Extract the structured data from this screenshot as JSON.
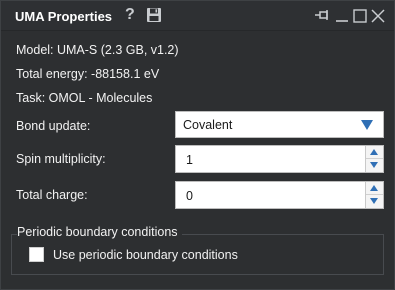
{
  "window": {
    "title": "UMA Properties",
    "help_icon_glyph": "?"
  },
  "info": {
    "model": "Model: UMA-S (2.3 GB, v1.2)",
    "total_energy": "Total energy: -88158.1 eV",
    "task": "Task: OMOL - Molecules"
  },
  "fields": {
    "bond_update_label": "Bond update:",
    "bond_update_value": "Covalent",
    "spin_label": "Spin multiplicity:",
    "spin_value": "1",
    "charge_label": "Total charge:",
    "charge_value": "0"
  },
  "periodic": {
    "group_title": "Periodic boundary conditions",
    "checkbox_label": "Use periodic boundary conditions",
    "checked": false
  },
  "icons": [
    "help-icon",
    "save-icon",
    "pin-icon",
    "minimize-icon",
    "maximize-icon",
    "close-icon",
    "chevron-down-icon",
    "spin-up-icon",
    "spin-down-icon"
  ],
  "colors": {
    "background": "#2d2f31",
    "accent": "#2f6fb5",
    "text": "#f2f2f2"
  }
}
